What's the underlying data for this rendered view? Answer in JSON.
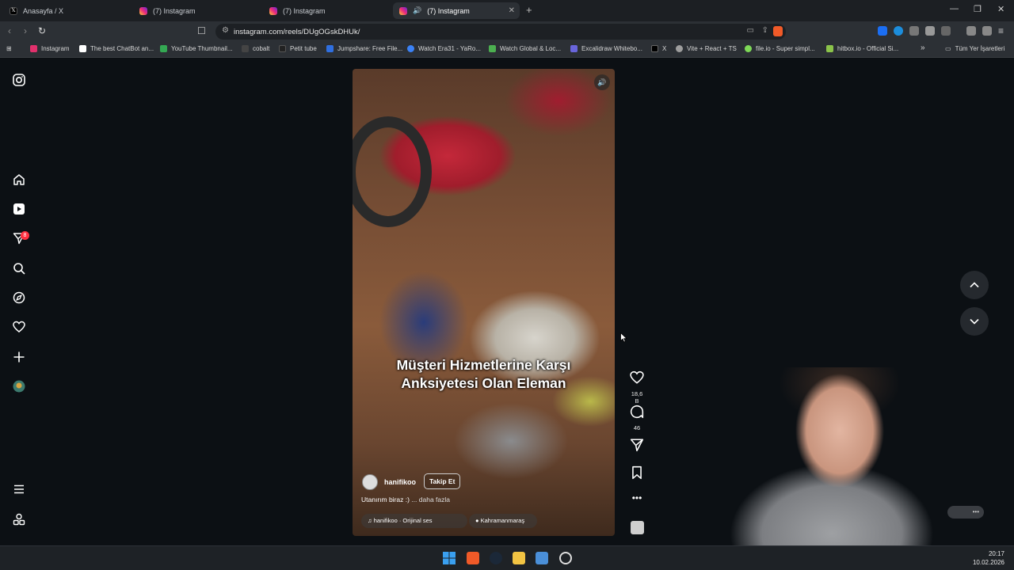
{
  "tabs": [
    {
      "title": "Anasayfa / X",
      "icon": "x-logo"
    },
    {
      "title": "(7) Instagram",
      "icon": "instagram-logo"
    },
    {
      "title": "(7) Instagram",
      "icon": "instagram-logo"
    },
    {
      "title": "(7) Instagram",
      "icon": "instagram-logo",
      "active": true,
      "audio": true
    }
  ],
  "address_bar": {
    "url": "instagram.com/reels/DUgOGskDHUk/"
  },
  "bookmarks": [
    {
      "label": "Instagram",
      "color": "#e1306c"
    },
    {
      "label": "The best ChatBot an...",
      "color": "#ffffff"
    },
    {
      "label": "YouTube Thumbnail...",
      "color": "#34a853"
    },
    {
      "label": "cobalt",
      "color": "#444444"
    },
    {
      "label": "Petit tube",
      "color": "#222222"
    },
    {
      "label": "Jumpshare: Free File...",
      "color": "#2f6fe0"
    },
    {
      "label": "Watch Era31 - YaRo...",
      "color": "#3b82f6"
    },
    {
      "label": "Watch Global & Loc...",
      "color": "#4caf50"
    },
    {
      "label": "Excalidraw Whitebo...",
      "color": "#6965db"
    },
    {
      "label": "X",
      "color": "#000000"
    },
    {
      "label": "Vite + React + TS",
      "color": "#9e9e9e"
    },
    {
      "label": "file.io - Super simpl...",
      "color": "#7ed957"
    },
    {
      "label": "hitbox.io - Official Si...",
      "color": "#8bc34a"
    }
  ],
  "bookmarks_folder": "Tüm Yer İşaretleri",
  "sidebar": {
    "notification_count": "8"
  },
  "reel": {
    "caption_line1": "Müşteri Hizmetlerine Karşı",
    "caption_line2": "Anksiyetesi Olan Eleman",
    "author": "hanifikoo",
    "follow_label": "Takip Et",
    "description": "Utanırım biraz :)",
    "more_label": "... daha fazla",
    "audio": "hanifikoo · Orijinal ses",
    "location": "Kahramanmaraş"
  },
  "actions": {
    "likes": "18,6 B",
    "comments": "46"
  },
  "taskbar": {
    "time": "20:17",
    "date": "10.02.2026"
  },
  "colors": {
    "accent_red": "#ff3040",
    "page_bg": "#0c1014"
  }
}
